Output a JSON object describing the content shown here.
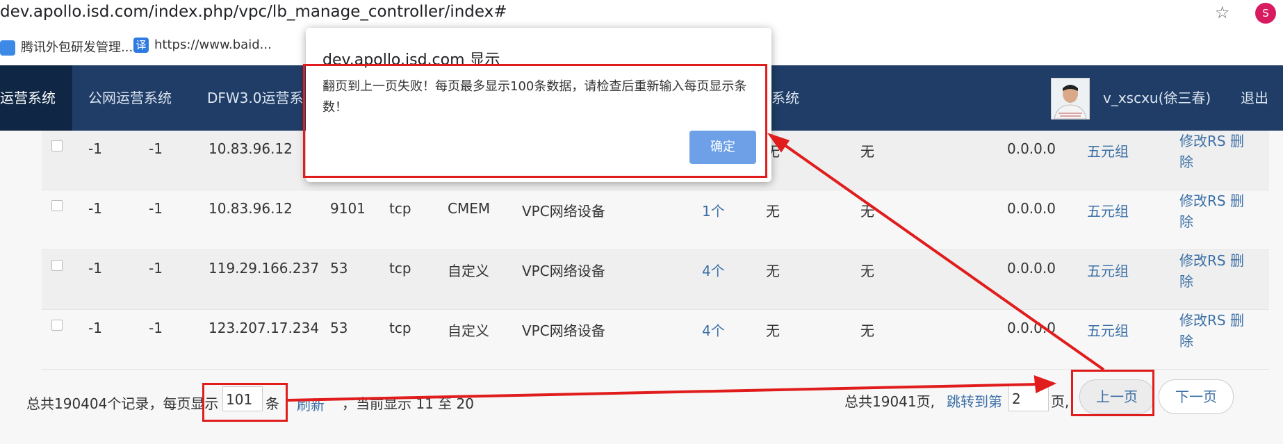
{
  "browser": {
    "url": "dev.apollo.isd.com/index.php/vpc/lb_manage_controller/index#",
    "profile_initial": "S",
    "bookmarks": [
      {
        "label": "腾讯外包研发管理...",
        "icon": "tencent-icon"
      },
      {
        "label": "https://www.baid...",
        "icon": "translate-icon",
        "icon_glyph": "译"
      }
    ]
  },
  "navbar": {
    "items": [
      {
        "label": "运营系统",
        "active": true
      },
      {
        "label": "公网运营系统"
      },
      {
        "label": "DFW3.0运营系"
      },
      {
        "label": "系统"
      }
    ],
    "user": "v_xscxu(徐三春)",
    "logout": "退出"
  },
  "table": {
    "rows": [
      {
        "c1": "-1",
        "c2": "-1",
        "ip": "10.83.96.12",
        "port": "",
        "protocol": "",
        "type": "",
        "device": "",
        "rs_count": "",
        "col_a": "无",
        "col_b": "无",
        "vip": "0.0.0.0",
        "tuple": "五元组",
        "edit": "修改RS",
        "del": "删除"
      },
      {
        "c1": "-1",
        "c2": "-1",
        "ip": "10.83.96.12",
        "port": "9101",
        "protocol": "tcp",
        "type": "CMEM",
        "device": "VPC网络设备",
        "rs_count": "1个",
        "col_a": "无",
        "col_b": "无",
        "vip": "0.0.0.0",
        "tuple": "五元组",
        "edit": "修改RS",
        "del": "删除"
      },
      {
        "c1": "-1",
        "c2": "-1",
        "ip": "119.29.166.237",
        "port": "53",
        "protocol": "tcp",
        "type": "自定义",
        "device": "VPC网络设备",
        "rs_count": "4个",
        "col_a": "无",
        "col_b": "无",
        "vip": "0.0.0.0",
        "tuple": "五元组",
        "edit": "修改RS",
        "del": "删除"
      },
      {
        "c1": "-1",
        "c2": "-1",
        "ip": "123.207.17.234",
        "port": "53",
        "protocol": "tcp",
        "type": "自定义",
        "device": "VPC网络设备",
        "rs_count": "4个",
        "col_a": "无",
        "col_b": "无",
        "vip": "0.0.0.0",
        "tuple": "五元组",
        "edit": "修改RS",
        "del": "删除"
      }
    ]
  },
  "pagination": {
    "total_records_prefix": "总共190404个记录，每页显示",
    "page_size_value": "101",
    "page_size_unit": "条",
    "refresh": "刷新",
    "range_text": "，当前显示 11 至 20",
    "total_pages": "总共19041页,",
    "jump_label": "跳转到第",
    "jump_value": "2",
    "jump_suffix": "页,",
    "prev": "上一页",
    "next": "下一页"
  },
  "dialog": {
    "title": "dev.apollo.isd.com 显示",
    "message": "翻页到上一页失败！每页最多显示100条数据，请检查后重新输入每页显示条数！",
    "ok": "确定"
  },
  "colors": {
    "navbar": "#1f3d66",
    "navbar_active": "#0f2745",
    "link": "#3a6ea5",
    "annotation": "#e01c1c",
    "dialog_button": "#6ea0e8"
  }
}
